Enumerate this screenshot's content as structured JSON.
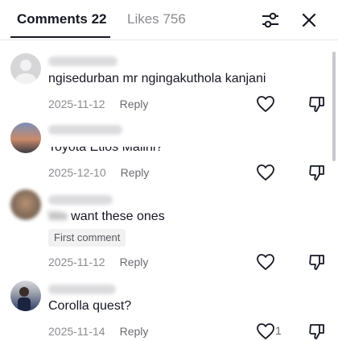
{
  "header": {
    "tab_comments": "Comments 22",
    "tab_likes": "Likes 756",
    "filter_icon": "filter-sliders-icon",
    "close_icon": "close-x-icon"
  },
  "comments": [
    {
      "text": "ngisedurban mr ngingakuthola kanjani",
      "date": "2025-11-12",
      "reply": "Reply",
      "likes": "",
      "avatar": "default-avatar"
    },
    {
      "text": "Toyota Etios Malini?",
      "date": "2025-12-10",
      "reply": "Reply",
      "likes": "",
      "avatar": "sunset-avatar"
    },
    {
      "text_blurred": "We",
      "text": "want these ones",
      "badge": "First comment",
      "date": "2025-11-12",
      "reply": "Reply",
      "likes": "",
      "avatar": "blurred-avatar"
    },
    {
      "text": "Corolla quest?",
      "date": "2025-11-14",
      "reply": "Reply",
      "likes": "1",
      "avatar": "person-avatar"
    }
  ],
  "colors": {
    "text": "#161823",
    "muted": "#8a8b91",
    "divider": "#e8e8ea"
  }
}
